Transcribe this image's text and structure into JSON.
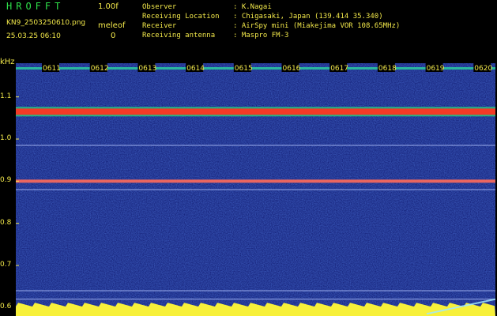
{
  "header": {
    "logo": "HROFFT",
    "version": "1.00f",
    "filename": "KN9_2503250610.png",
    "meleo_label": "meleof",
    "datetime": "25.03.25 06:10",
    "count": "0"
  },
  "metadata": [
    {
      "key": "Observer",
      "value": ": K.Nagai"
    },
    {
      "key": "Receiving Location",
      "value": ": Chigasaki, Japan (139.414 35.340)"
    },
    {
      "key": "Receiver",
      "value": ": AirSpy mini (Miakejima VOR 108.65MHz)"
    },
    {
      "key": "Receiving antenna",
      "value": ": Maspro FM-3"
    }
  ],
  "axis": {
    "unit": "kHz",
    "y_ticks": [
      "1.1",
      "1.0",
      "0.9",
      "0.8",
      "0.7",
      "0.6"
    ],
    "y_values": [
      1.1,
      1.0,
      0.9,
      0.8,
      0.7,
      0.6
    ],
    "y_range": [
      0.58,
      1.18
    ],
    "time_labels": [
      "0611",
      "0612",
      "0613",
      "0614",
      "0615",
      "0616",
      "0617",
      "0618",
      "0619",
      "0620"
    ]
  },
  "bands": [
    {
      "freq": 1.065,
      "kind": "strong"
    },
    {
      "freq": 0.985,
      "kind": "thin"
    },
    {
      "freq": 0.9,
      "kind": "medium"
    },
    {
      "freq": 0.88,
      "kind": "thin"
    },
    {
      "freq": 0.64,
      "kind": "thin"
    },
    {
      "freq": 0.62,
      "kind": "thin"
    }
  ],
  "colors": {
    "header_text": "#f2e84a",
    "logo": "#2ee04a",
    "background_noise": "#1b2a8c",
    "strong_band": "#ff2b2b",
    "medium_band": "#ff7a3a",
    "floor": "#f7f03a"
  }
}
